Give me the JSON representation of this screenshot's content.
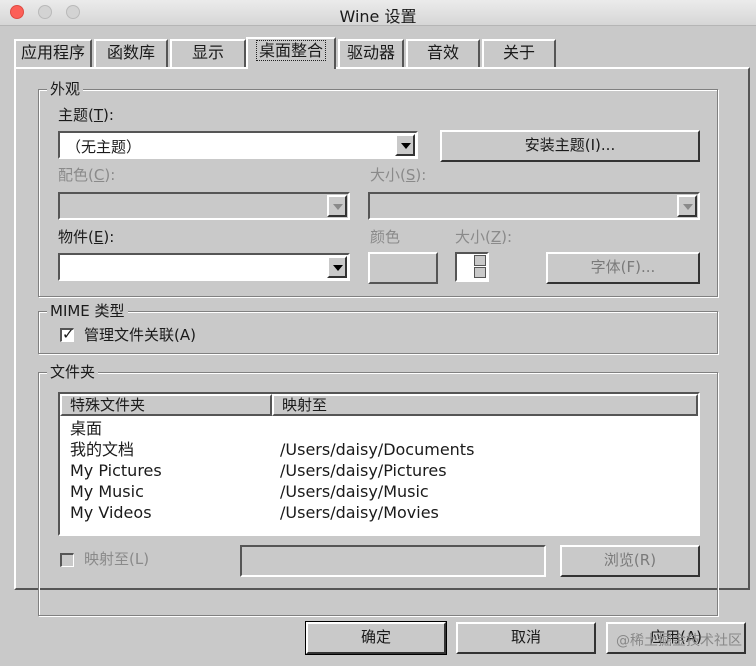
{
  "window": {
    "title": "Wine 设置"
  },
  "tabs": [
    {
      "label": "应用程序"
    },
    {
      "label": "函数库"
    },
    {
      "label": "显示"
    },
    {
      "label": "桌面整合"
    },
    {
      "label": "驱动器"
    },
    {
      "label": "音效"
    },
    {
      "label": "关于"
    }
  ],
  "appearance": {
    "group_label": "外观",
    "theme_label": "主题",
    "theme_accel": "T",
    "theme_value": "（无主题）",
    "install_theme_button": "安装主题(I)...",
    "color_label": "配色",
    "color_accel": "C",
    "size_label": "大小",
    "size_accel": "S",
    "item_label": "物件",
    "item_accel": "E",
    "item_color_label": "颜色",
    "item_size_label": "大小",
    "item_size_accel": "Z",
    "font_button": "字体(F)..."
  },
  "mime": {
    "group_label": "MIME 类型",
    "manage_assoc_label": "管理文件关联(A)",
    "manage_assoc_checked": true
  },
  "folders": {
    "group_label": "文件夹",
    "col_special": "特殊文件夹",
    "col_mapped": "映射至",
    "rows": [
      {
        "name": "桌面",
        "path": ""
      },
      {
        "name": "我的文档",
        "path": "/Users/daisy/Documents"
      },
      {
        "name": "My Pictures",
        "path": "/Users/daisy/Pictures"
      },
      {
        "name": "My Music",
        "path": "/Users/daisy/Music"
      },
      {
        "name": "My Videos",
        "path": "/Users/daisy/Movies"
      }
    ],
    "map_to_label": "映射至(L)",
    "map_to_checked": false,
    "browse_button": "浏览(R)"
  },
  "footer": {
    "ok_button": "确定",
    "cancel_button": "取消",
    "apply_button": "应用(A)"
  },
  "watermark": "@稀土掘金技术社区"
}
